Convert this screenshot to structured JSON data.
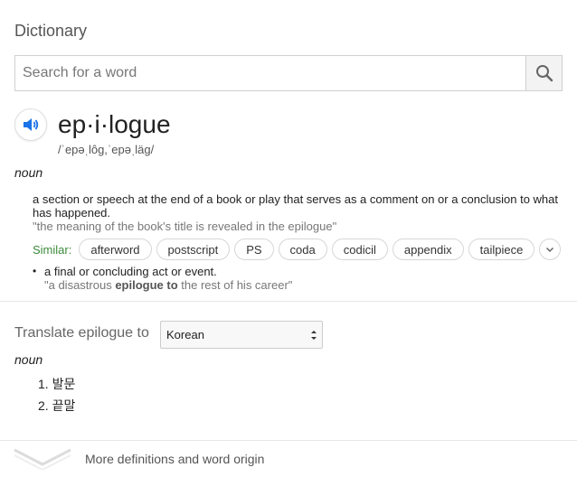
{
  "header": {
    "title": "Dictionary"
  },
  "search": {
    "placeholder": "Search for a word",
    "value": ""
  },
  "entry": {
    "headword": "ep·i·logue",
    "phonetic": "/ˈepəˌlôg,ˈepəˌläg/",
    "part_of_speech": "noun",
    "senses": [
      {
        "definition": "a section or speech at the end of a book or play that serves as a comment on or a conclusion to what has happened.",
        "example": "\"the meaning of the book's title is revealed in the epilogue\""
      },
      {
        "definition": "a final or concluding act or event.",
        "example_pre": "\"a disastrous ",
        "example_bold": "epilogue to",
        "example_post": " the rest of his career\""
      }
    ],
    "similar_label": "Similar:",
    "similar": [
      "afterword",
      "postscript",
      "PS",
      "coda",
      "codicil",
      "appendix",
      "tailpiece"
    ]
  },
  "translate": {
    "label": "Translate epilogue to",
    "language": "Korean",
    "part_of_speech": "noun",
    "translations": [
      "1. 발문",
      "2. 끝말"
    ]
  },
  "footer": {
    "more_label": "More definitions and word origin"
  },
  "colors": {
    "accent_blue": "#1a73e8",
    "similar_green": "#3c8a3c"
  },
  "icons": {
    "search": "search-icon",
    "speaker": "speaker-icon",
    "chevron": "chevron-down-icon"
  }
}
